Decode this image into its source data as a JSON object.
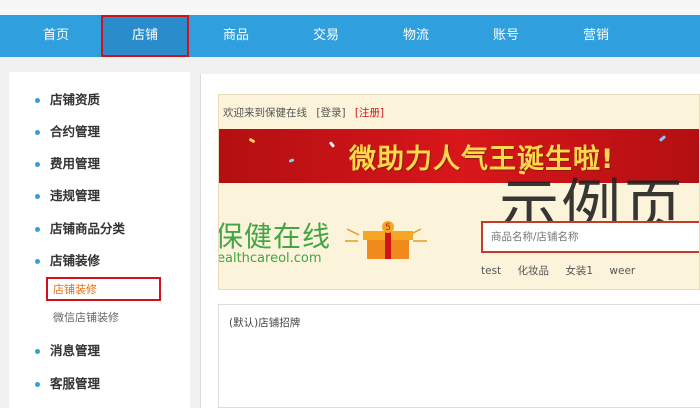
{
  "nav": {
    "items": [
      "首页",
      "店铺",
      "商品",
      "交易",
      "物流",
      "账号",
      "营销"
    ],
    "active_index": 1
  },
  "sidebar": {
    "items": [
      {
        "label": "店铺资质"
      },
      {
        "label": "合约管理"
      },
      {
        "label": "费用管理"
      },
      {
        "label": "违规管理"
      },
      {
        "label": "店铺商品分类"
      },
      {
        "label": "店铺装修"
      },
      {
        "label": "消息管理"
      },
      {
        "label": "客服管理"
      }
    ],
    "sub_items": [
      {
        "label": "店铺装修",
        "active": true
      },
      {
        "label": "微信店铺装修",
        "active": false
      }
    ]
  },
  "preview": {
    "welcome_text": "欢迎来到保健在线",
    "login_label": "[登录]",
    "register_label": "[注册]",
    "banner_text": "微助力人气王诞生啦!",
    "logo_cn": "保健在线",
    "logo_en": "ealthcareol.com",
    "watermark": "示例页",
    "search_placeholder": "商品名称/店铺名称",
    "hot_words": [
      "test",
      "化妆品",
      "女装1",
      "weer"
    ]
  },
  "section2": {
    "title": "(默认)店铺招牌"
  },
  "colors": {
    "nav_bg": "#2f9fde",
    "highlight_border": "#d0121b",
    "logo_green": "#43a545",
    "banner_red": "#d8161b"
  }
}
